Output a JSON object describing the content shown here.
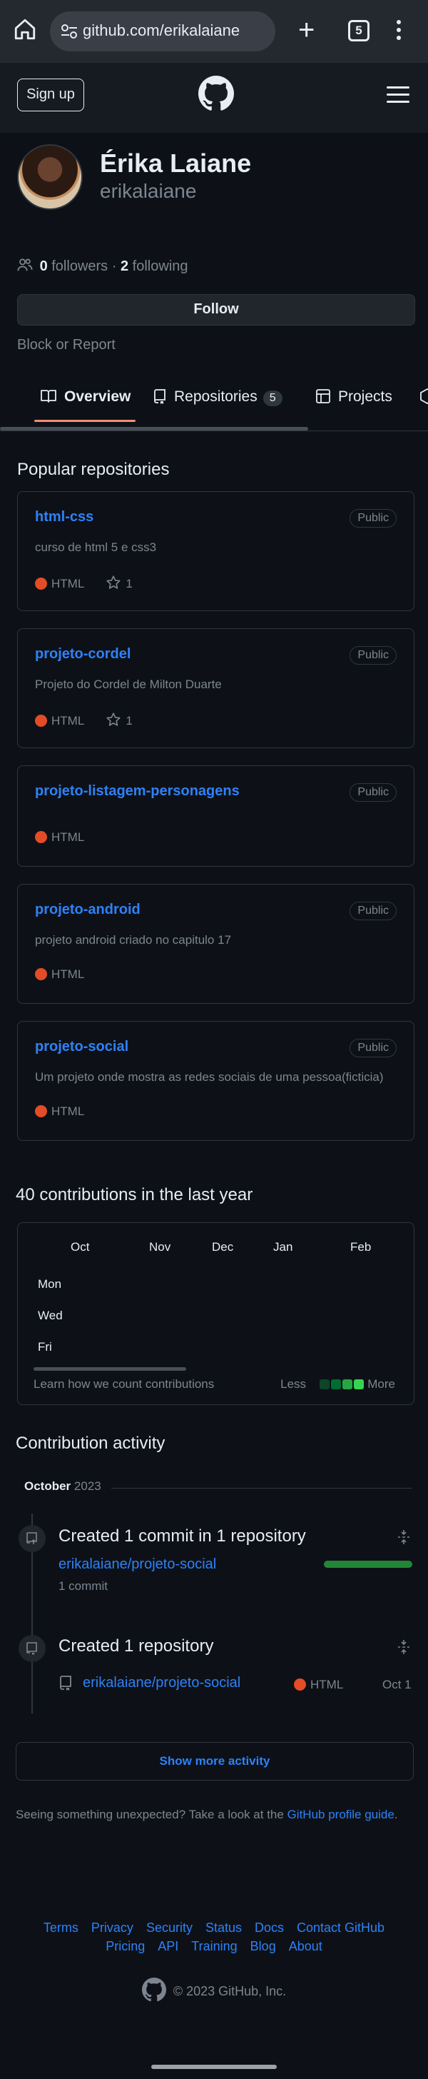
{
  "browser": {
    "url": "github.com/erikalaiane",
    "tab_count": "5"
  },
  "header": {
    "signup_label": "Sign up"
  },
  "profile": {
    "name": "Érika Laiane",
    "login": "erikalaiane",
    "followers_count": "0",
    "followers_label": "followers",
    "separator": "·",
    "following_count": "2",
    "following_label": "following",
    "follow_label": "Follow",
    "block_label": "Block or Report"
  },
  "tabs": [
    {
      "label": "Overview",
      "active": true
    },
    {
      "label": "Repositories",
      "count": "5"
    },
    {
      "label": "Projects"
    }
  ],
  "popular": {
    "title": "Popular repositories",
    "repos": [
      {
        "name": "html-css",
        "visibility": "Public",
        "description": "curso de html 5 e css3",
        "language": "HTML",
        "stars": "1"
      },
      {
        "name": "projeto-cordel",
        "visibility": "Public",
        "description": "Projeto do Cordel de Milton Duarte",
        "language": "HTML",
        "stars": "1"
      },
      {
        "name": "projeto-listagem-personagens",
        "visibility": "Public",
        "description": "",
        "language": "HTML"
      },
      {
        "name": "projeto-android",
        "visibility": "Public",
        "description": "projeto android criado no capitulo 17",
        "language": "HTML"
      },
      {
        "name": "projeto-social",
        "visibility": "Public",
        "description": "Um projeto onde mostra as redes sociais de uma pessoa(ficticia)",
        "language": "HTML"
      }
    ]
  },
  "contributions": {
    "title": "40 contributions in the last year",
    "months": [
      "Oct",
      "Nov",
      "Dec",
      "Jan",
      "Feb"
    ],
    "days": [
      "Mon",
      "Wed",
      "Fri"
    ],
    "learn_label": "Learn how we count contributions",
    "less_label": "Less",
    "more_label": "More",
    "legend_colors": [
      "#0e4429",
      "#006d32",
      "#26a641",
      "#39d353"
    ]
  },
  "activity": {
    "title": "Contribution activity",
    "month": "October",
    "year": "2023",
    "events": [
      {
        "title": "Created 1 commit in 1 repository",
        "repo": "erikalaiane/projeto-social",
        "detail": "1 commit"
      },
      {
        "title": "Created 1 repository",
        "repo": "erikalaiane/projeto-social",
        "language": "HTML",
        "date": "Oct 1"
      }
    ],
    "show_more_label": "Show more activity",
    "unexpected_text": "Seeing something unexpected? Take a look at the",
    "guide_link": "GitHub profile guide",
    "period": "."
  },
  "footer": {
    "row1": [
      "Terms",
      "Privacy",
      "Security",
      "Status",
      "Docs",
      "Contact GitHub"
    ],
    "row2": [
      "Pricing",
      "API",
      "Training",
      "Blog",
      "About"
    ],
    "copyright": "© 2023 GitHub, Inc."
  },
  "colors": {
    "link": "#2f81f7",
    "html_lang": "#e34c26",
    "tab_underline": "#fd8c73"
  }
}
